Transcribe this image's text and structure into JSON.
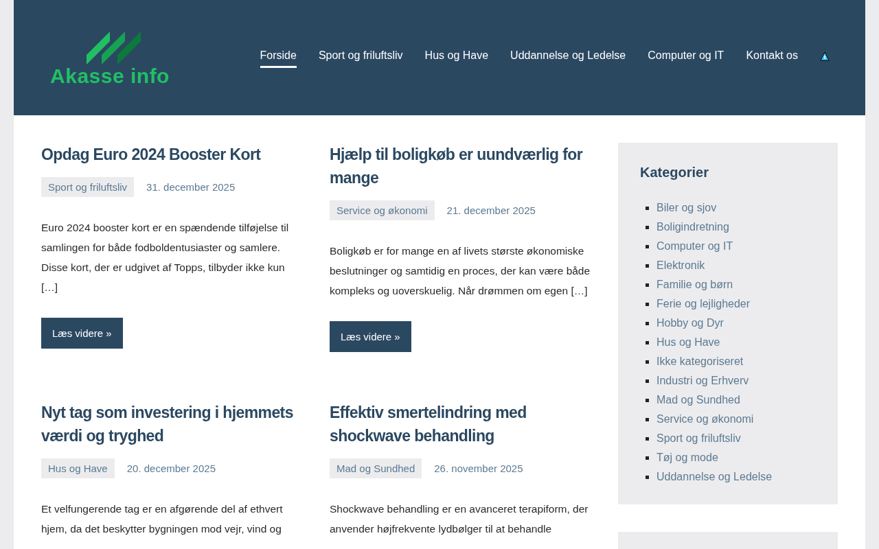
{
  "site": {
    "logo_text": "Akasse info"
  },
  "nav": [
    {
      "label": "Forside",
      "selected": true
    },
    {
      "label": "Sport og friluftsliv",
      "selected": false
    },
    {
      "label": "Hus og Have",
      "selected": false
    },
    {
      "label": "Uddannelse og Ledelse",
      "selected": false
    },
    {
      "label": "Computer og IT",
      "selected": false
    },
    {
      "label": "Kontakt os",
      "selected": false
    }
  ],
  "posts": [
    {
      "title": "Opdag Euro 2024 Booster Kort",
      "category": "Sport og friluftsliv",
      "date": "31. december 2025",
      "excerpt": "Euro 2024 booster kort er en spændende tilføjelse til samlingen for både fodboldentusiaster og samlere. Disse kort, der er udgivet af Topps, tilbyder ikke kun […]",
      "button": "Læs videre »"
    },
    {
      "title": "Hjælp til boligkøb er uundværlig for mange",
      "category": "Service og økonomi",
      "date": "21. december 2025",
      "excerpt": "Boligkøb er for mange en af livets største økonomiske beslutninger og samtidig en proces, der kan være både kompleks og uoverskuelig. Når drømmen om egen […]",
      "button": "Læs videre »"
    },
    {
      "title": "Nyt tag som investering i hjemmets værdi og tryghed",
      "category": "Hus og Have",
      "date": "20. december 2025",
      "excerpt": "Et velfungerende tag er en afgørende del af ethvert hjem, da det beskytter bygningen mod vejr, vind og"
    },
    {
      "title": "Effektiv smertelindring med shockwave behandling",
      "category": "Mad og Sundhed",
      "date": "26. november 2025",
      "excerpt": "Shockwave behandling er en avanceret terapiform, der anvender højfrekvente lydbølger til at behandle"
    }
  ],
  "sidebar": {
    "title": "Kategorier",
    "items": [
      "Biler og sjov",
      "Boligindretning",
      "Computer og IT",
      "Elektronik",
      "Familie og børn",
      "Ferie og lejligheder",
      "Hobby og Dyr",
      "Hus og Have",
      "Ikke kategoriseret",
      "Industri og Erhverv",
      "Mad og Sundhed",
      "Service og økonomi",
      "Sport og friluftsliv",
      "Tøj og mode",
      "Uddannelse og Ledelse"
    ]
  }
}
